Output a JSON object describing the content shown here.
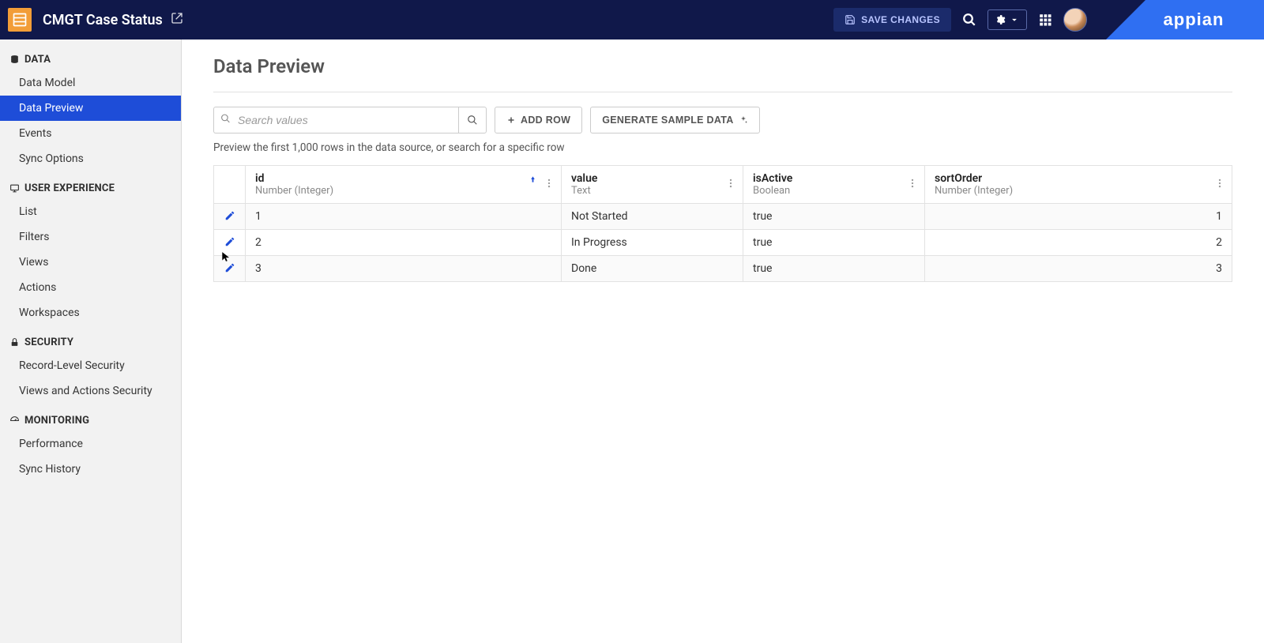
{
  "header": {
    "title": "CMGT Case Status",
    "save_label": "SAVE CHANGES",
    "brand": "appian"
  },
  "sidebar": {
    "sections": [
      {
        "label": "DATA",
        "items": [
          "Data Model",
          "Data Preview",
          "Events",
          "Sync Options"
        ],
        "active_index": 1
      },
      {
        "label": "USER EXPERIENCE",
        "items": [
          "List",
          "Filters",
          "Views",
          "Actions",
          "Workspaces"
        ]
      },
      {
        "label": "SECURITY",
        "items": [
          "Record-Level Security",
          "Views and Actions Security"
        ]
      },
      {
        "label": "MONITORING",
        "items": [
          "Performance",
          "Sync History"
        ]
      }
    ]
  },
  "page": {
    "title": "Data Preview",
    "search_placeholder": "Search values",
    "add_row_label": "ADD ROW",
    "gen_sample_label": "GENERATE SAMPLE DATA",
    "helper": "Preview the first 1,000 rows in the data source, or search for a specific row"
  },
  "table": {
    "columns": [
      {
        "name": "id",
        "type": "Number (Integer)",
        "sorted": "asc"
      },
      {
        "name": "value",
        "type": "Text"
      },
      {
        "name": "isActive",
        "type": "Boolean"
      },
      {
        "name": "sortOrder",
        "type": "Number (Integer)",
        "align": "right"
      }
    ],
    "rows": [
      {
        "id": "1",
        "value": "Not Started",
        "isActive": "true",
        "sortOrder": "1"
      },
      {
        "id": "2",
        "value": "In Progress",
        "isActive": "true",
        "sortOrder": "2"
      },
      {
        "id": "3",
        "value": "Done",
        "isActive": "true",
        "sortOrder": "3"
      }
    ]
  }
}
